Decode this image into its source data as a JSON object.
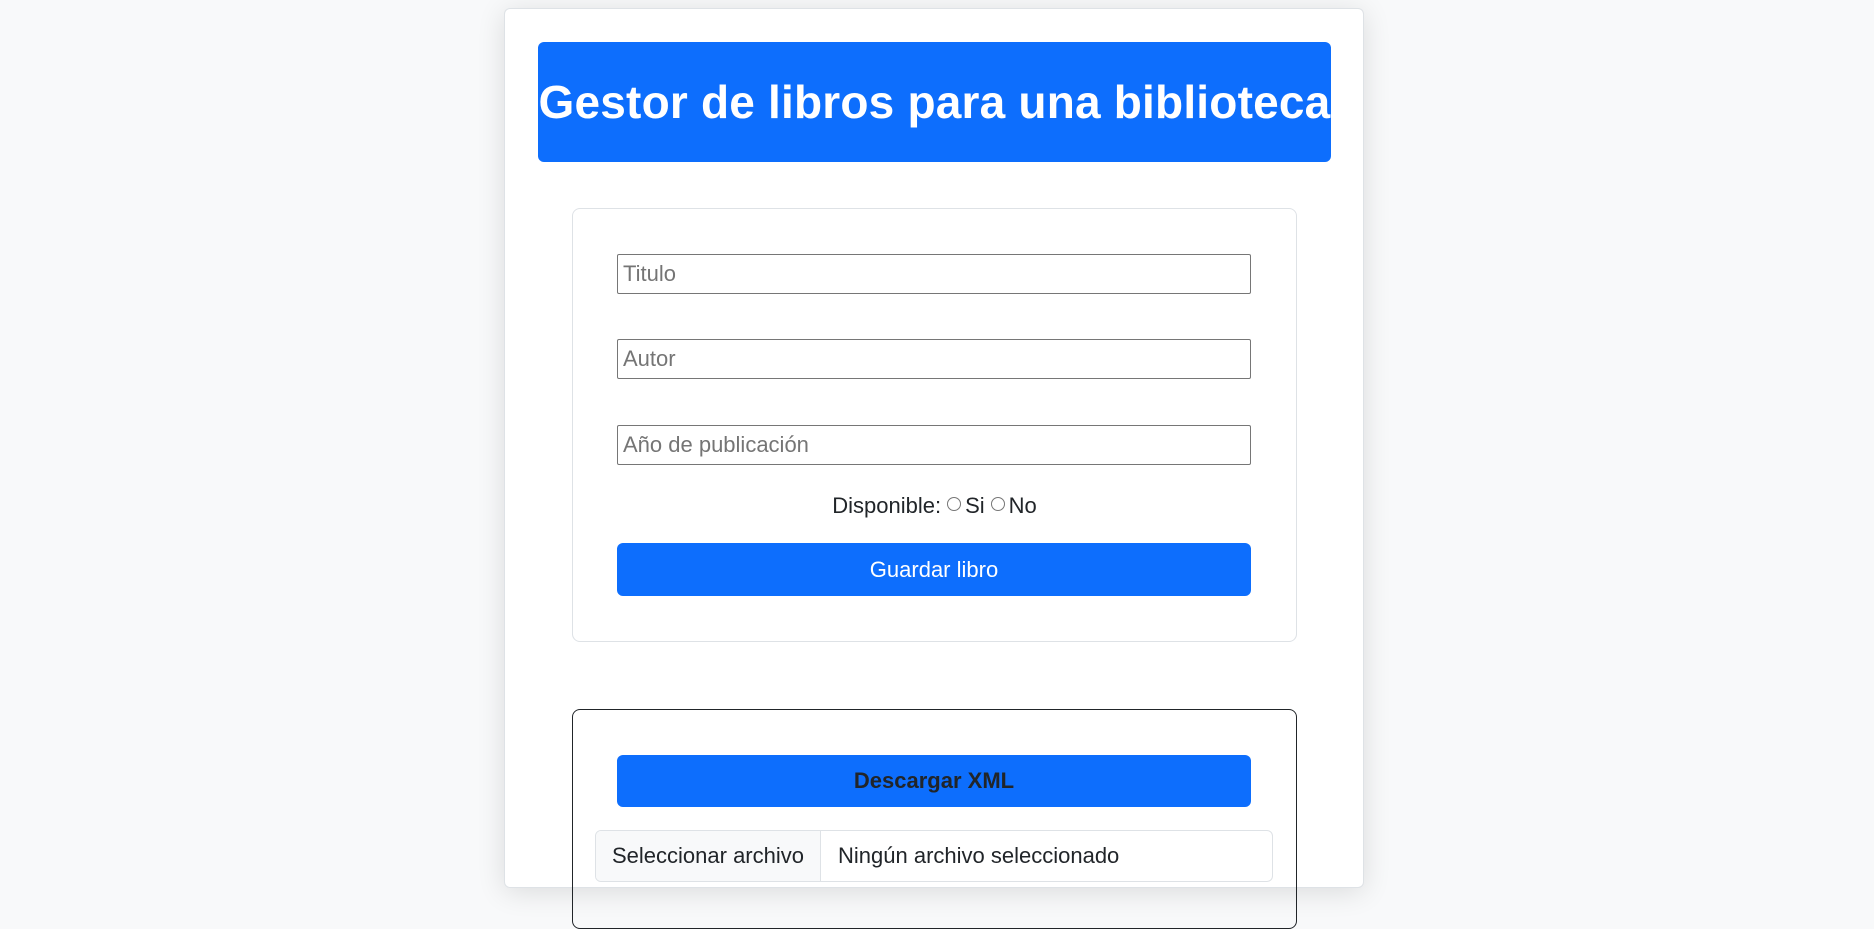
{
  "header": {
    "title": "Gestor de libros para una biblioteca"
  },
  "form": {
    "titulo_placeholder": "Titulo",
    "titulo_value": "",
    "autor_placeholder": "Autor",
    "autor_value": "",
    "anio_placeholder": "Año de publicación",
    "anio_value": "",
    "disponible_label": "Disponible:",
    "option_si": "Si",
    "option_no": "No",
    "save_label": "Guardar libro"
  },
  "xml": {
    "download_label": "Descargar XML",
    "file_button_label": "Seleccionar archivo",
    "file_status": "Ningún archivo seleccionado"
  },
  "colors": {
    "primary": "#0d6efd",
    "background": "#f8f9fa"
  }
}
